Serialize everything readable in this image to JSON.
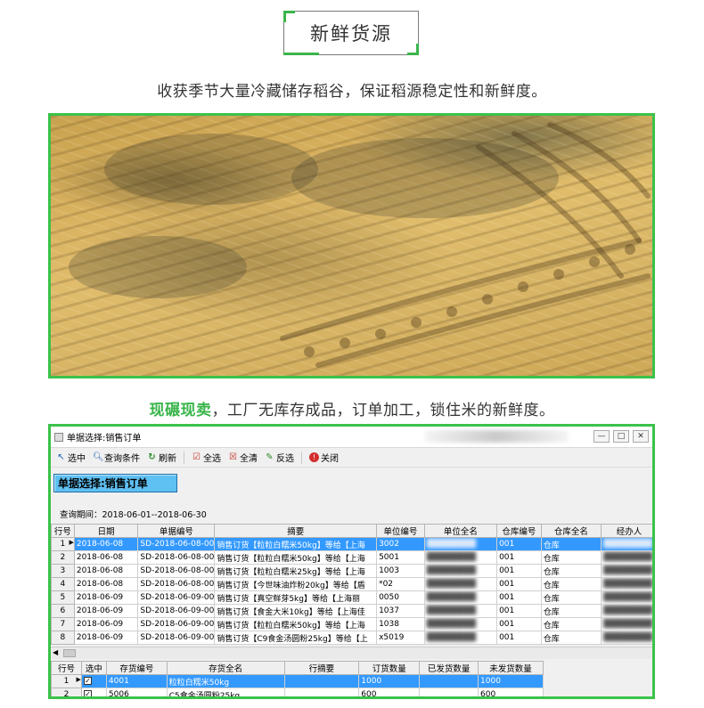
{
  "header": {
    "title": "新鲜货源"
  },
  "caption1": "收获季节大量冷藏储存稻谷，保证稻源稳定性和新鲜度。",
  "caption2": {
    "highlight": "现碾现卖",
    "rest": "，工厂无库存成品，订单加工，锁住米的新鲜度。"
  },
  "photo": {
    "subject": "稻谷晾晒"
  },
  "window": {
    "title": "单据选择:销售订单",
    "controls": {
      "min": "—",
      "max": "□",
      "close": "✕"
    },
    "toolbar": [
      {
        "label": "选中",
        "icon": "cursor-icon"
      },
      {
        "label": "查询条件",
        "icon": "search-icon"
      },
      {
        "label": "刷新",
        "icon": "refresh-icon"
      },
      {
        "label": "全选",
        "icon": "select-all-icon"
      },
      {
        "label": "全清",
        "icon": "clear-all-icon"
      },
      {
        "label": "反选",
        "icon": "invert-select-icon"
      },
      {
        "label": "关闭",
        "icon": "close-circle-icon"
      }
    ],
    "heading": "单据选择:销售订单",
    "period": "查询期间：2018-06-01--2018-06-30",
    "orders": {
      "columns": [
        "行号",
        "日期",
        "单据编号",
        "摘要",
        "单位编号",
        "单位全名",
        "仓库编号",
        "仓库全名",
        "经办人"
      ],
      "rows": [
        [
          "1",
          "2018-06-08",
          "SD-2018-06-08-00",
          "销售订货【粒粒白糯米50kg】等给【上海",
          "3002",
          "",
          "001",
          "仓库",
          ""
        ],
        [
          "2",
          "2018-06-08",
          "SD-2018-06-08-00",
          "销售订货【粒粒白糯米50kg】等给【上海",
          "5001",
          "",
          "001",
          "仓库",
          ""
        ],
        [
          "3",
          "2018-06-08",
          "SD-2018-06-08-00",
          "销售订货【粒粒白糯米25kg】等给【上海",
          "1003",
          "",
          "001",
          "仓库",
          ""
        ],
        [
          "4",
          "2018-06-08",
          "SD-2018-06-08-00",
          "销售订货【今世味油炸粉20kg】等给【盾",
          "*02",
          "",
          "001",
          "仓库",
          ""
        ],
        [
          "5",
          "2018-06-09",
          "SD-2018-06-09-00",
          "销售订货【真空鲜芽5kg】等给【上海丽",
          "0050",
          "",
          "001",
          "仓库",
          ""
        ],
        [
          "6",
          "2018-06-09",
          "SD-2018-06-09-00",
          "销售订货【食金大米10kg】等给【上海佳",
          "1037",
          "",
          "001",
          "仓库",
          ""
        ],
        [
          "7",
          "2018-06-09",
          "SD-2018-06-09-00",
          "销售订货【粒粒白糯米50kg】等给【上海",
          "1038",
          "",
          "001",
          "仓库",
          ""
        ],
        [
          "8",
          "2018-06-09",
          "SD-2018-06-09-00",
          "销售订货【C9食金汤圆粉25kg】等给【上",
          "x5019",
          "",
          "001",
          "仓库",
          ""
        ]
      ]
    },
    "details": {
      "columns": [
        "行号",
        "选中",
        "存货编号",
        "存货全名",
        "行摘要",
        "订货数量",
        "已发货数量",
        "未发货数量"
      ],
      "rows": [
        [
          "1",
          "✓",
          "4001",
          "粒粒白糯米50kg",
          "",
          "1000",
          "",
          "1000"
        ],
        [
          "2",
          "✓",
          "5006",
          "C5食金汤圆粉25kg",
          "",
          "600",
          "",
          "600"
        ]
      ]
    }
  }
}
